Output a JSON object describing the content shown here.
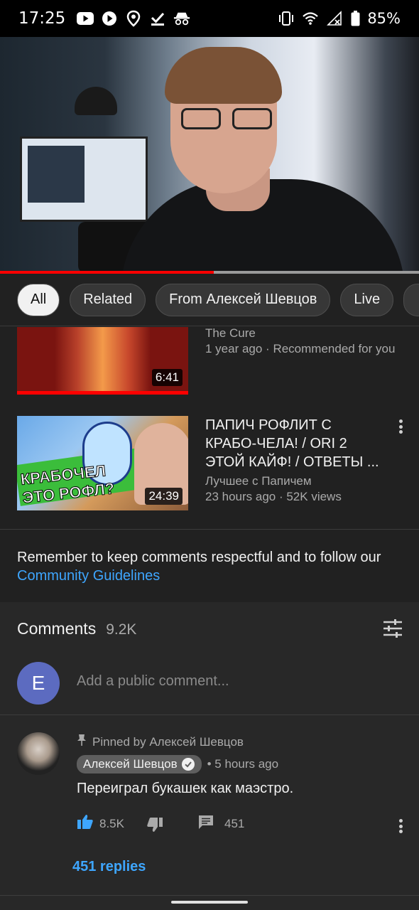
{
  "status_bar": {
    "time": "17:25",
    "battery_percent": "85%",
    "left_icons": [
      "youtube-icon",
      "play-icon",
      "location-icon",
      "download-done-icon",
      "incognito-icon"
    ],
    "right_icons": [
      "vibrate-icon",
      "wifi-icon",
      "signal-icon",
      "battery-icon"
    ]
  },
  "video": {
    "progress_fraction": 0.51,
    "progress_color": "#ff0000"
  },
  "chips": [
    {
      "label": "All",
      "selected": true
    },
    {
      "label": "Related",
      "selected": false
    },
    {
      "label": "From Алексей Шевцов",
      "selected": false
    },
    {
      "label": "Live",
      "selected": false
    }
  ],
  "videos": [
    {
      "title": "The Cure",
      "meta": "1 year ago · Recommended for you",
      "duration": "6:41"
    },
    {
      "title": "ПАПИЧ РОФЛИТ С КРАБО-ЧЕЛА! / ORI 2 ЭТОЙ КАЙФ! / ОТВЕТЫ ...",
      "channel": "Лучшее с Папичем",
      "meta": "23 hours ago · 52K views",
      "duration": "24:39",
      "thumb_text": [
        "КРАБОЧЕЛ",
        "ЭТО РОФЛ?"
      ]
    }
  ],
  "guidelines": {
    "text": "Remember to keep comments respectful and to follow our ",
    "link": "Community Guidelines"
  },
  "comments": {
    "title": "Comments",
    "count": "9.2K",
    "avatar_letter": "E",
    "avatar_color": "#5c6bc0",
    "placeholder": "Add a public comment...",
    "pinned": {
      "pinned_label": "Pinned by Алексей Шевцов",
      "author": "Алексей Шевцов",
      "time": "• 5 hours ago",
      "text": "Переиграл букашек как маэстро.",
      "likes": "8.5K",
      "reply_count": "451",
      "replies_label": "451 replies"
    }
  },
  "colors": {
    "background": "#212121",
    "accent_link": "#3ea6ff",
    "like_active": "#3ea6ff"
  }
}
